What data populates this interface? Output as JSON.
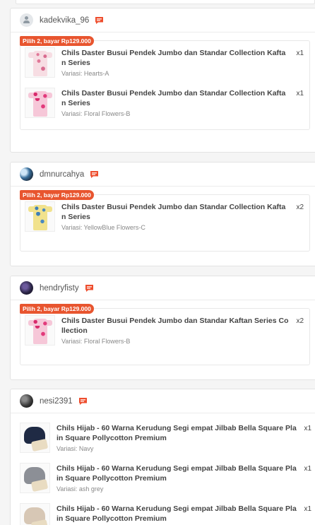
{
  "orders": [
    {
      "username": "kadekvika_96",
      "avatar": "default-user-icon",
      "promo": "Pilih 2, bayar Rp129.000",
      "items": [
        {
          "title": "Chils Daster Busui Pendek Jumbo dan Standar Collection Kaftan Series",
          "variant": "Variasi: Hearts-A",
          "qty": "x1"
        },
        {
          "title": "Chils Daster Busui Pendek Jumbo dan Standar Collection Kaftan Series",
          "variant": "Variasi: Floral Flowers-B",
          "qty": "x1"
        }
      ]
    },
    {
      "username": "dmnurcahya",
      "promo": "Pilih 2, bayar Rp129.000",
      "items": [
        {
          "title": "Chils Daster Busui Pendek Jumbo dan Standar Collection Kaftan Series",
          "variant": "Variasi: YellowBlue Flowers-C",
          "qty": "x2"
        }
      ]
    },
    {
      "username": "hendryfisty",
      "promo": "Pilih 2, bayar Rp129.000",
      "items": [
        {
          "title": "Chils Daster Busui Pendek Jumbo dan Standar Kaftan Series Collection",
          "variant": "Variasi: Floral Flowers-B",
          "qty": "x2"
        }
      ]
    },
    {
      "username": "nesi2391",
      "items": [
        {
          "title": "Chils Hijab - 60 Warna Kerudung Segi empat Jilbab Bella Square Plain Square Pollycotton Premium",
          "variant": "Variasi: Navy",
          "qty": "x1"
        },
        {
          "title": "Chils Hijab - 60 Warna Kerudung Segi empat Jilbab Bella Square Plain Square Pollycotton Premium",
          "variant": "Variasi: ash grey",
          "qty": "x1"
        },
        {
          "title": "Chils Hijab - 60 Warna Kerudung Segi empat Jilbab Bella Square Plain Square Pollycotton Premium",
          "variant": "",
          "qty": "x1"
        }
      ]
    }
  ],
  "colors": {
    "promo": "#e8552f",
    "chat_icon": "#ee4d2d"
  },
  "icons": {
    "chat": "chat-bubble-icon",
    "avatar_default": "user-icon"
  }
}
